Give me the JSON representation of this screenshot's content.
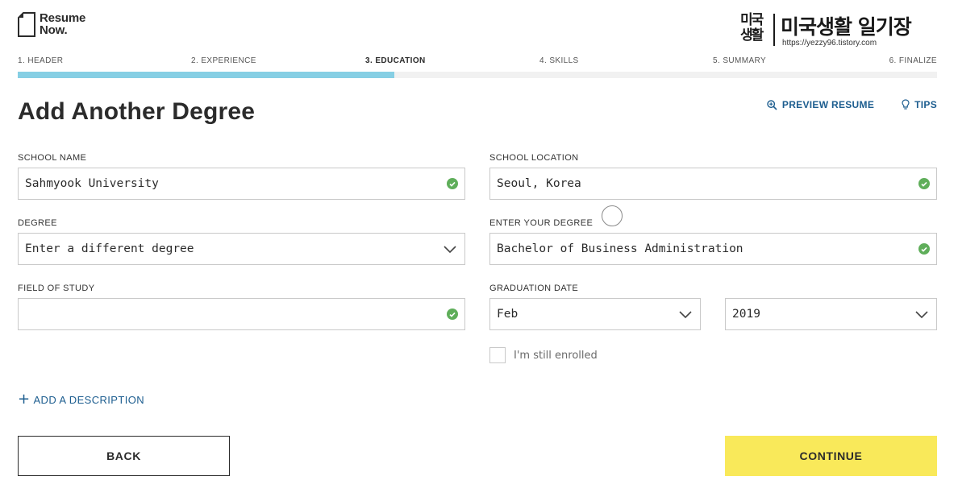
{
  "brand": {
    "line1": "Resume",
    "line2": "Now."
  },
  "watermark": {
    "seal_line1": "미국",
    "seal_line2": "생활",
    "title": "미국생활 일기장",
    "url": "https://yezzy96.tistory.com"
  },
  "steps": [
    {
      "label": "1. HEADER"
    },
    {
      "label": "2. EXPERIENCE"
    },
    {
      "label": "3. EDUCATION"
    },
    {
      "label": "4. SKILLS"
    },
    {
      "label": "5. SUMMARY"
    },
    {
      "label": "6. FINALIZE"
    }
  ],
  "progress": {
    "current_step": 3,
    "total_steps": 6,
    "fraction": 0.41
  },
  "page_title": "Add Another Degree",
  "top_links": {
    "preview": "PREVIEW RESUME",
    "tips": "TIPS"
  },
  "form": {
    "school_name": {
      "label": "SCHOOL NAME",
      "value": "Sahmyook University",
      "valid": true
    },
    "school_location": {
      "label": "SCHOOL LOCATION",
      "value": "Seoul, Korea",
      "valid": true
    },
    "degree": {
      "label": "DEGREE",
      "value": "Enter a different degree"
    },
    "enter_degree": {
      "label": "ENTER YOUR DEGREE",
      "value": "Bachelor of Business Administration",
      "valid": true
    },
    "field_of_study": {
      "label": "FIELD OF STUDY",
      "value": "",
      "valid": true
    },
    "graduation": {
      "label": "GRADUATION DATE",
      "month": "Feb",
      "year": "2019"
    },
    "enrolled": {
      "label": "I'm still enrolled",
      "checked": false
    }
  },
  "add_description": "ADD A DESCRIPTION",
  "buttons": {
    "back": "BACK",
    "continue": "CONTINUE"
  },
  "colors": {
    "progress": "#86cfe4",
    "link": "#1c5d8f",
    "valid": "#5fae5a",
    "continue_bg": "#f9e95a"
  }
}
